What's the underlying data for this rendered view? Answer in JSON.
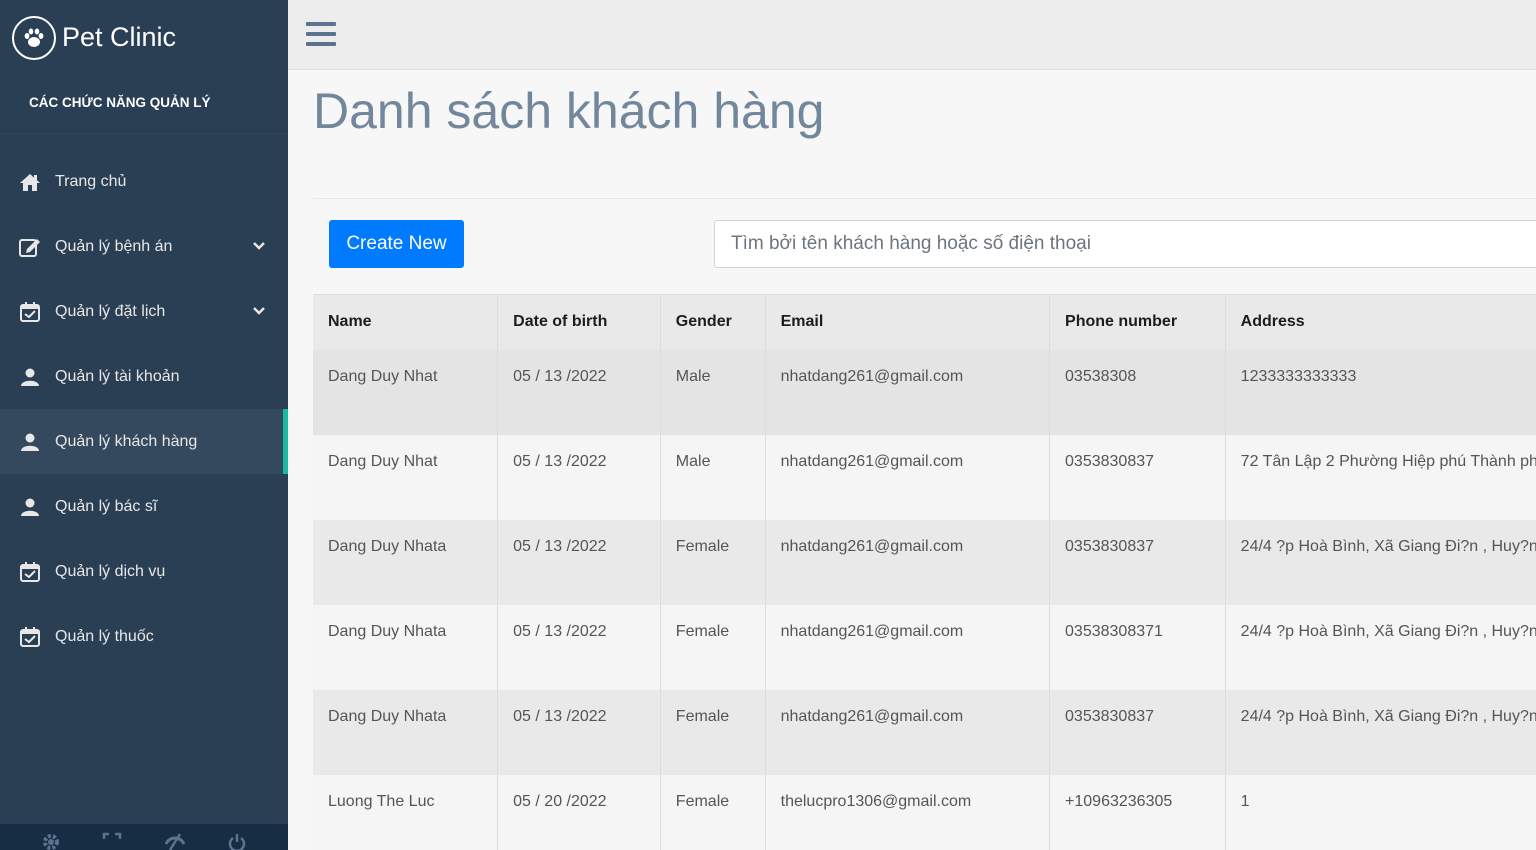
{
  "app": {
    "title": "Pet Clinic",
    "logo_icon": "paw-icon"
  },
  "sidebar": {
    "section_title": "CÁC CHỨC NĂNG QUẢN LÝ",
    "items": [
      {
        "label": "Trang chủ",
        "icon": "home-icon",
        "has_submenu": false,
        "active": false
      },
      {
        "label": "Quản lý bệnh án",
        "icon": "edit-icon",
        "has_submenu": true,
        "active": false
      },
      {
        "label": "Quản lý đặt lịch",
        "icon": "calendar-check-icon",
        "has_submenu": true,
        "active": false
      },
      {
        "label": "Quản lý tài khoản",
        "icon": "user-icon",
        "has_submenu": false,
        "active": false
      },
      {
        "label": "Quản lý khách hàng",
        "icon": "user-icon",
        "has_submenu": false,
        "active": true
      },
      {
        "label": "Quản lý bác sĩ",
        "icon": "user-icon",
        "has_submenu": false,
        "active": false
      },
      {
        "label": "Quản lý dịch vụ",
        "icon": "calendar-check-icon",
        "has_submenu": false,
        "active": false
      },
      {
        "label": "Quản lý thuốc",
        "icon": "calendar-check-icon",
        "has_submenu": false,
        "active": false
      }
    ],
    "footer_icons": [
      "settings-icon",
      "fullscreen-icon",
      "eye-slash-icon",
      "power-icon"
    ]
  },
  "main": {
    "title": "Danh sách khách hàng",
    "create_label": "Create New",
    "search_placeholder": "Tìm bởi tên khách hàng hoặc số điện thoại",
    "table": {
      "headers": [
        "Name",
        "Date of birth",
        "Gender",
        "Email",
        "Phone number",
        "Address"
      ],
      "rows": [
        [
          "Dang Duy Nhat",
          "05 / 13 /2022",
          "Male",
          "nhatdang261@gmail.com",
          "03538308",
          "1233333333333"
        ],
        [
          "Dang Duy Nhat",
          "05 / 13 /2022",
          "Male",
          "nhatdang261@gmail.com",
          "0353830837",
          "72 Tân Lập 2 Phường Hiệp phú Thành ph"
        ],
        [
          "Dang Duy Nhata",
          "05 / 13 /2022",
          "Female",
          "nhatdang261@gmail.com",
          "0353830837",
          "24/4 ?p Hoà Bình, Xã Giang Đi?n , Huy?n"
        ],
        [
          "Dang Duy Nhata",
          "05 / 13 /2022",
          "Female",
          "nhatdang261@gmail.com",
          "03538308371",
          "24/4 ?p Hoà Bình, Xã Giang Đi?n , Huy?n"
        ],
        [
          "Dang Duy Nhata",
          "05 / 13 /2022",
          "Female",
          "nhatdang261@gmail.com",
          "0353830837",
          "24/4 ?p Hoà Bình, Xã Giang Đi?n , Huy?n"
        ],
        [
          "Luong The Luc",
          "05 / 20 /2022",
          "Female",
          "thelucpro1306@gmail.com",
          "+10963236305",
          "1"
        ]
      ]
    }
  },
  "colors": {
    "sidebar": "#2a3f54",
    "accent": "#1abb9c",
    "primary_button": "#007bff",
    "title": "#73879c"
  }
}
